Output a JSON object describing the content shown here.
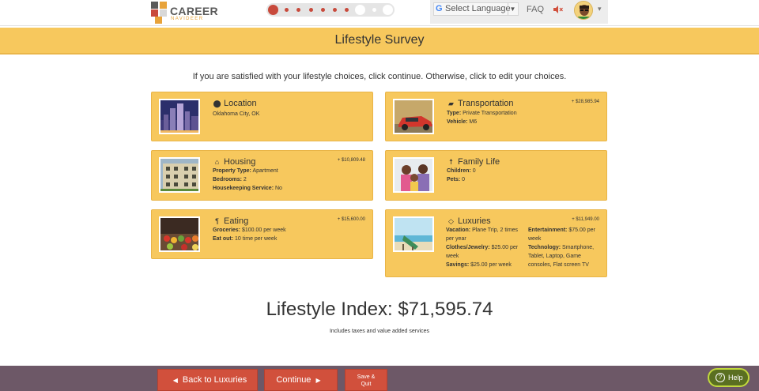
{
  "header": {
    "logo_line1": "CAREER",
    "logo_line2": "NAVIDEER",
    "progress": {
      "total_steps": 10,
      "current_step": 1
    },
    "language": {
      "g_icon": "G",
      "label": "Select Language",
      "dropdown_icon": "triangle-down-icon"
    },
    "faq_label": "FAQ",
    "sound_icon": "speaker-muted-icon",
    "avatar_icon": "user-avatar-icon",
    "avatar_caret": "▾"
  },
  "page": {
    "title": "Lifestyle Survey",
    "intro": "If you are satisfied with your lifestyle choices, click continue. Otherwise, click to edit your choices."
  },
  "cards": {
    "location": {
      "icon": "map-marker-icon",
      "title": "Location",
      "value": "Oklahoma City, OK"
    },
    "transportation": {
      "icon": "car-icon",
      "title": "Transportation",
      "cost": "+ $28,985.94",
      "type_label": "Type:",
      "type_value": "Private Transportation",
      "vehicle_label": "Vehicle:",
      "vehicle_value": "M6"
    },
    "housing": {
      "icon": "home-icon",
      "title": "Housing",
      "cost": "+ $10,809.48",
      "property_label": "Property Type:",
      "property_value": "Apartment",
      "bedrooms_label": "Bedrooms:",
      "bedrooms_value": "2",
      "housekeeping_label": "Housekeeping Service:",
      "housekeeping_value": "No"
    },
    "family": {
      "icon": "child-icon",
      "title": "Family Life",
      "children_label": "Children:",
      "children_value": "0",
      "pets_label": "Pets:",
      "pets_value": "0"
    },
    "eating": {
      "icon": "utensils-icon",
      "title": "Eating",
      "cost": "+ $15,600.00",
      "groceries_label": "Groceries:",
      "groceries_value": "$100.00 per week",
      "eatout_label": "Eat out:",
      "eatout_value": "10 time per week"
    },
    "luxuries": {
      "icon": "diamond-icon",
      "title": "Luxuries",
      "cost": "+ $11,949.00",
      "vacation_label": "Vacation:",
      "vacation_value": "Plane Trip, 2 times per year",
      "clothes_label": "Clothes/Jewelry:",
      "clothes_value": "$25.00 per week",
      "savings_label": "Savings:",
      "savings_value": "$25.00 per week",
      "entertainment_label": "Entertainment:",
      "entertainment_value": "$75.00 per week",
      "technology_label": "Technology:",
      "technology_value": "Smartphone, Tablet, Laptop, Game consoles, Flat screen TV"
    }
  },
  "summary": {
    "index_text": "Lifestyle Index: $71,595.74",
    "note": "Includes taxes and value added services"
  },
  "footer": {
    "back_label": "Back to Luxuries",
    "continue_label": "Continue",
    "save_line1": "Save &",
    "save_line2": "Quit",
    "help_label": "Help",
    "help_icon": "question-circle-icon"
  },
  "colors": {
    "accent_yellow": "#f7c85d",
    "button_red": "#d1503c",
    "footer_purple": "#6d5867",
    "help_green": "#5a6f21"
  }
}
